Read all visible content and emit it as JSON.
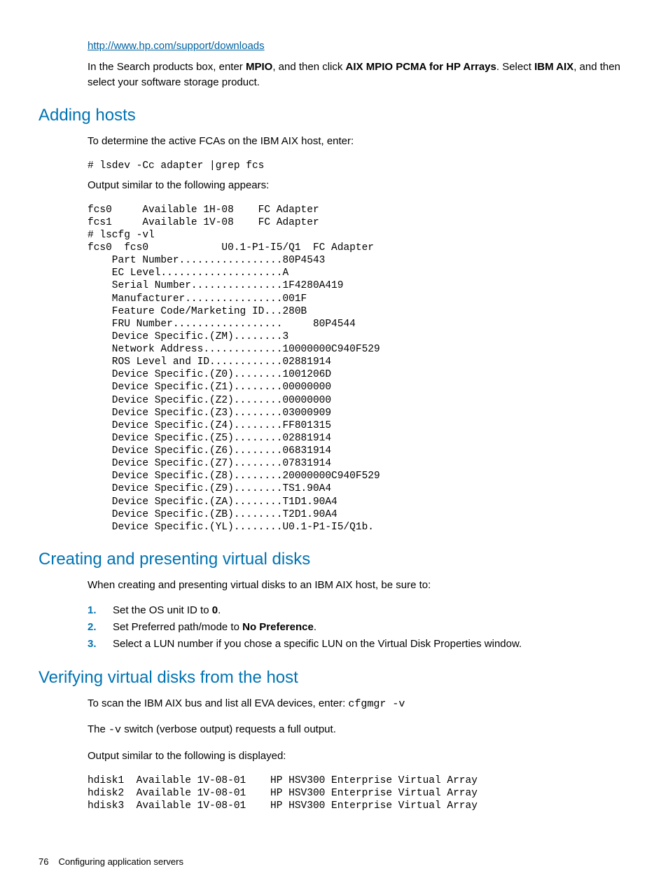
{
  "url": "http://www.hp.com/support/downloads",
  "intro_para": {
    "pre": "In the Search products box, enter ",
    "b1": "MPIO",
    "mid1": ", and then click ",
    "b2": "AIX MPIO PCMA for HP Arrays",
    "mid2": ". Select ",
    "b3": "IBM AIX",
    "post": ", and then select your software storage product."
  },
  "s1": {
    "heading": "Adding hosts",
    "p1": "To determine the active FCAs on the IBM AIX host, enter:",
    "cmd1": "# lsdev -Cc adapter |grep fcs",
    "p2": "Output similar to the following appears:",
    "out": "fcs0     Available 1H-08    FC Adapter\nfcs1     Available 1V-08    FC Adapter\n# lscfg -vl\nfcs0  fcs0            U0.1-P1-I5/Q1  FC Adapter\n    Part Number.................80P4543\n    EC Level....................A\n    Serial Number...............1F4280A419\n    Manufacturer................001F\n    Feature Code/Marketing ID...280B\n    FRU Number..................     80P4544\n    Device Specific.(ZM)........3\n    Network Address.............10000000C940F529\n    ROS Level and ID............02881914\n    Device Specific.(Z0)........1001206D\n    Device Specific.(Z1)........00000000\n    Device Specific.(Z2)........00000000\n    Device Specific.(Z3)........03000909\n    Device Specific.(Z4)........FF801315\n    Device Specific.(Z5)........02881914\n    Device Specific.(Z6)........06831914\n    Device Specific.(Z7)........07831914\n    Device Specific.(Z8)........20000000C940F529\n    Device Specific.(Z9)........TS1.90A4\n    Device Specific.(ZA)........T1D1.90A4\n    Device Specific.(ZB)........T2D1.90A4\n    Device Specific.(YL)........U0.1-P1-I5/Q1b."
  },
  "s2": {
    "heading": "Creating and presenting virtual disks",
    "p1": "When creating and presenting virtual disks to an IBM AIX host, be sure to:",
    "li1": {
      "pre": "Set the OS unit ID to ",
      "b": "0",
      "post": "."
    },
    "li2": {
      "pre": "Set Preferred path/mode to ",
      "b": "No Preference",
      "post": "."
    },
    "li3": "Select a LUN number if you chose a specific LUN on the Virtual Disk Properties window."
  },
  "s3": {
    "heading": "Verifying virtual disks from the host",
    "p1": {
      "pre": "To scan the IBM AIX bus and list all EVA devices, enter: ",
      "code": "cfgmgr -v"
    },
    "p2": {
      "pre": "The ",
      "code": "-v",
      "post": " switch (verbose output) requests a full output."
    },
    "p3": "Output similar to the following is displayed:",
    "out": "hdisk1  Available 1V-08-01    HP HSV300 Enterprise Virtual Array\nhdisk2  Available 1V-08-01    HP HSV300 Enterprise Virtual Array\nhdisk3  Available 1V-08-01    HP HSV300 Enterprise Virtual Array"
  },
  "footer": {
    "page": "76",
    "title": "Configuring application servers"
  }
}
